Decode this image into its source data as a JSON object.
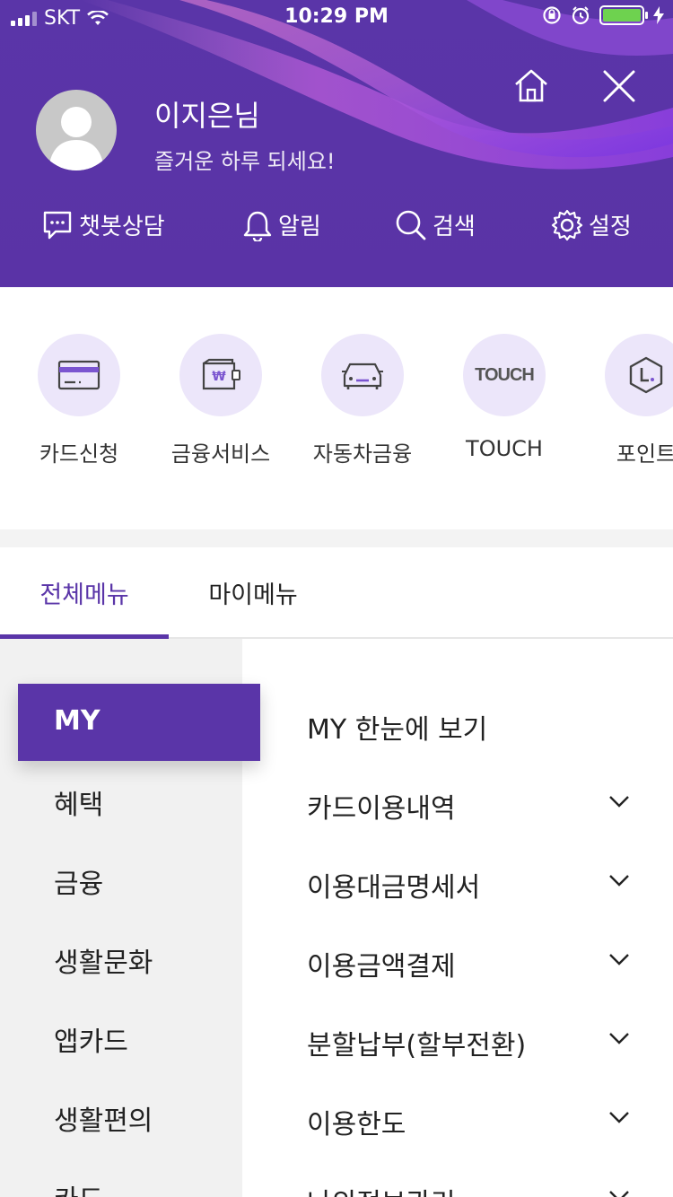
{
  "status": {
    "carrier": "SKT",
    "time": "10:29 PM"
  },
  "profile": {
    "name": "이지은님",
    "greeting": "즐거운 하루 되세요!"
  },
  "quick_actions": [
    {
      "label": "챗봇상담",
      "icon": "chatbot-icon"
    },
    {
      "label": "알림",
      "icon": "bell-icon"
    },
    {
      "label": "검색",
      "icon": "search-icon"
    },
    {
      "label": "설정",
      "icon": "gear-icon"
    }
  ],
  "services": [
    {
      "label": "카드신청",
      "icon": "card-icon"
    },
    {
      "label": "금융서비스",
      "icon": "wallet-icon"
    },
    {
      "label": "자동차금융",
      "icon": "car-icon"
    },
    {
      "label": "TOUCH",
      "icon": "touch-logo",
      "logo_text": "TOUCH"
    },
    {
      "label": "포인트",
      "icon": "point-icon"
    }
  ],
  "tabs": [
    {
      "label": "전체메뉴",
      "active": true
    },
    {
      "label": "마이메뉴",
      "active": false
    }
  ],
  "categories": [
    {
      "label": "MY",
      "selected": true
    },
    {
      "label": "혜택"
    },
    {
      "label": "금융"
    },
    {
      "label": "생활문화"
    },
    {
      "label": "앱카드"
    },
    {
      "label": "생활편의"
    },
    {
      "label": "카드"
    }
  ],
  "submenu": [
    {
      "label": "MY 한눈에 보기",
      "expandable": false
    },
    {
      "label": "카드이용내역",
      "expandable": true
    },
    {
      "label": "이용대금명세서",
      "expandable": true
    },
    {
      "label": "이용금액결제",
      "expandable": true
    },
    {
      "label": "분할납부(할부전환)",
      "expandable": true
    },
    {
      "label": "이용한도",
      "expandable": true
    },
    {
      "label": "나의정보관리",
      "expandable": true
    }
  ],
  "colors": {
    "brand": "#5a35a8",
    "icon_bg": "#ece6fa",
    "battery": "#6ed24f"
  }
}
